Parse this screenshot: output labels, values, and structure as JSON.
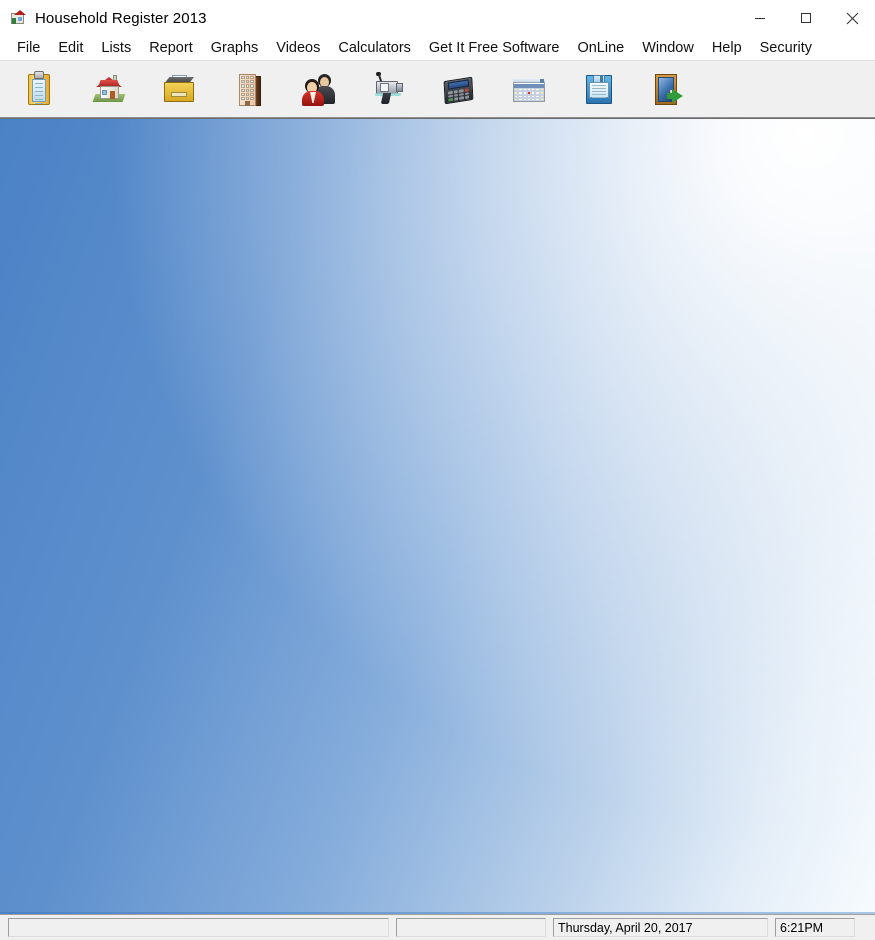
{
  "window": {
    "title": "Household Register 2013",
    "icon": "house-register-icon",
    "controls": [
      {
        "name": "minimize-button",
        "glyph": "minimize-icon",
        "label": "Minimize"
      },
      {
        "name": "maximize-button",
        "glyph": "maximize-icon",
        "label": "Maximize"
      },
      {
        "name": "close-button",
        "glyph": "close-icon",
        "label": "Close"
      }
    ]
  },
  "menu": {
    "items": [
      {
        "label": "File"
      },
      {
        "label": "Edit"
      },
      {
        "label": "Lists"
      },
      {
        "label": "Report"
      },
      {
        "label": "Graphs"
      },
      {
        "label": "Videos"
      },
      {
        "label": "Calculators"
      },
      {
        "label": "Get It Free Software"
      },
      {
        "label": "OnLine"
      },
      {
        "label": "Window"
      },
      {
        "label": "Help"
      },
      {
        "label": "Security"
      }
    ]
  },
  "toolbar": {
    "buttons": [
      {
        "name": "register-button",
        "icon": "clipboard-icon",
        "tooltip": "Register"
      },
      {
        "name": "household-button",
        "icon": "house-icon",
        "tooltip": "Household"
      },
      {
        "name": "files-button",
        "icon": "file-drawer-icon",
        "tooltip": "Files"
      },
      {
        "name": "property-button",
        "icon": "building-icon",
        "tooltip": "Property"
      },
      {
        "name": "people-button",
        "icon": "two-people-icon",
        "tooltip": "People"
      },
      {
        "name": "videos-button",
        "icon": "video-camera-icon",
        "tooltip": "Videos"
      },
      {
        "name": "calculator-button",
        "icon": "calculator-icon",
        "tooltip": "Calculator"
      },
      {
        "name": "calendar-button",
        "icon": "calendar-icon",
        "tooltip": "Calendar"
      },
      {
        "name": "save-button",
        "icon": "floppy-disk-icon",
        "tooltip": "Save"
      },
      {
        "name": "exit-button",
        "icon": "exit-door-icon",
        "tooltip": "Exit"
      }
    ]
  },
  "status_bar": {
    "message": "",
    "secondary": "",
    "date": "Thursday, April 20, 2017",
    "time": "6:21PM"
  },
  "colors": {
    "client_blue": "#4f84c4",
    "client_highlight": "#ffffff",
    "toolbar_bg": "#f0f0f0",
    "titlebar_bg": "#ffffff",
    "close_hover": "#e81123",
    "text": "#000000"
  }
}
